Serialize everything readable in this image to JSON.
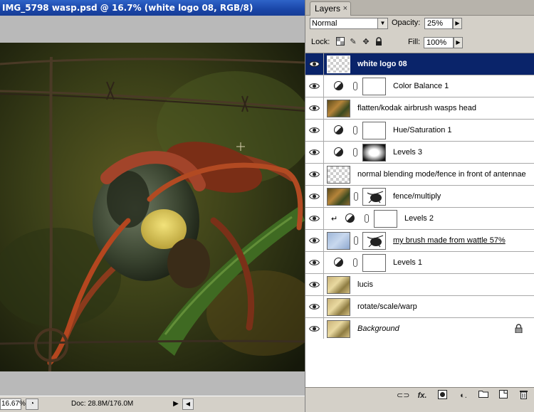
{
  "document": {
    "title": "IMG_5798 wasp.psd @ 16.7% (white logo 08, RGB/8)",
    "zoom": "16.67%",
    "doc_info": "Doc: 28.8M/176.0M"
  },
  "layers_panel": {
    "tab_label": "Layers",
    "tab_close": "×",
    "blend_mode": "Normal",
    "opacity_label": "Opacity:",
    "opacity_value": "25%",
    "lock_label": "Lock:",
    "fill_label": "Fill:",
    "fill_value": "100%",
    "layers": [
      {
        "name": "white logo 08",
        "selected": true,
        "kind": "pixel",
        "thumb": "checker"
      },
      {
        "name": "Color Balance 1",
        "kind": "adjustment",
        "mask": "white"
      },
      {
        "name": "flatten/kodak airbrush wasps head",
        "kind": "pixel",
        "thumb": "photo"
      },
      {
        "name": "Hue/Saturation 1",
        "kind": "adjustment",
        "mask": "white"
      },
      {
        "name": "Levels 3",
        "kind": "adjustment",
        "mask": "levels"
      },
      {
        "name": "normal blending mode/fence in front of antennae",
        "kind": "pixel",
        "thumb": "checker"
      },
      {
        "name": "fence/multiply",
        "kind": "masked",
        "thumb": "photo",
        "mask": "wasp"
      },
      {
        "name": "Levels 2",
        "kind": "adjustment-clipped",
        "mask": "white"
      },
      {
        "name": "my brush made from wattle 57%",
        "kind": "masked",
        "thumb": "blue",
        "mask": "wasp",
        "underline": true
      },
      {
        "name": "Levels 1",
        "kind": "adjustment",
        "mask": "white"
      },
      {
        "name": "lucis",
        "kind": "pixel",
        "thumb": "photo-light"
      },
      {
        "name": "rotate/scale/warp",
        "kind": "pixel",
        "thumb": "photo-light"
      },
      {
        "name": "Background",
        "kind": "background",
        "thumb": "photo-light",
        "italic": true,
        "locked": true
      }
    ],
    "footer_icons": [
      "link-layers-icon",
      "layer-style-icon",
      "add-mask-icon",
      "new-adjustment-layer-icon",
      "new-group-icon",
      "new-layer-icon",
      "delete-layer-icon"
    ]
  }
}
